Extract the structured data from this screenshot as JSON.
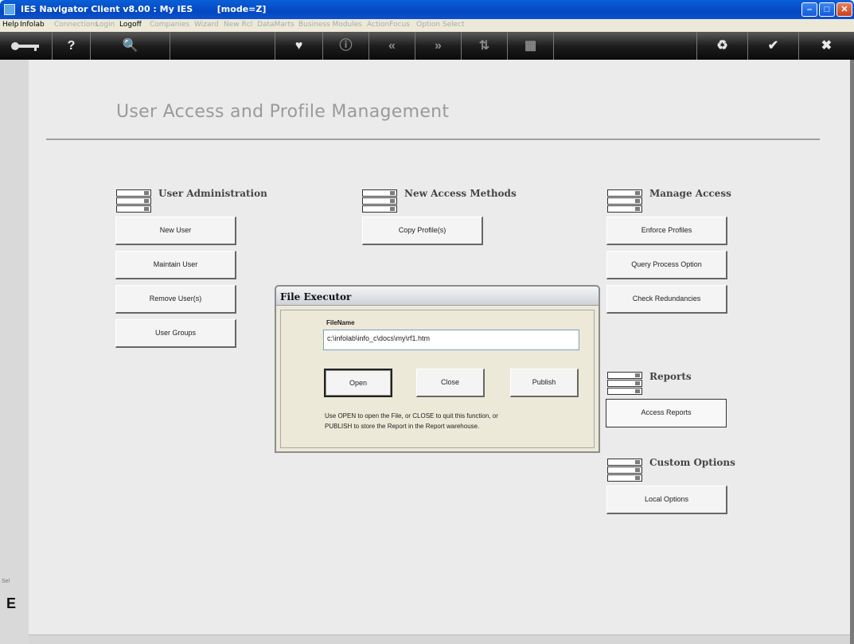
{
  "window": {
    "title": "IES Navigator Client v8.00 : My IES        [mode=Z]",
    "min_label": "–",
    "max_label": "□",
    "close_label": "✕"
  },
  "menu": [
    {
      "label": "Help",
      "dim": false
    },
    {
      "label": "Infolab",
      "dim": false
    },
    {
      "label": "Connections",
      "dim": true
    },
    {
      "label": "Login",
      "dim": true
    },
    {
      "label": "Logoff",
      "dim": false
    },
    {
      "label": "Companies",
      "dim": true
    },
    {
      "label": "Wizard",
      "dim": true
    },
    {
      "label": "New Rcl",
      "dim": true
    },
    {
      "label": "DataMarts",
      "dim": true
    },
    {
      "label": "Business Modules",
      "dim": true
    },
    {
      "label": "ActionFocus",
      "dim": true
    },
    {
      "label": "Option Select",
      "dim": true
    }
  ],
  "toolbar": {
    "key_icon": "key-icon",
    "help_icon": "?",
    "search_icon": "🔍",
    "heart_icon": "♥",
    "info_icon": "ⓘ",
    "back_icon": "«",
    "forward_icon": "»",
    "sort_icon": "⇅",
    "grid_icon": "▦",
    "refresh_icon": "♻",
    "ok_icon": "✔",
    "close_icon": "✖"
  },
  "page": {
    "title": "User Access and Profile Management"
  },
  "sections": {
    "user_admin": {
      "heading": "User Administration",
      "buttons": [
        "New User",
        "Maintain User",
        "Remove User(s)",
        "User Groups"
      ]
    },
    "new_access": {
      "heading": "New Access Methods",
      "buttons": [
        "Copy Profile(s)"
      ]
    },
    "manage_access": {
      "heading": "Manage Access",
      "buttons": [
        "Enforce Profiles",
        "Query Process Option",
        "Check Redundancies"
      ]
    },
    "reports": {
      "heading": "Reports",
      "buttons": [
        "Access Reports"
      ]
    },
    "custom_options": {
      "heading": "Custom Options",
      "buttons": [
        "Local Options"
      ]
    }
  },
  "dialog": {
    "title": "File Executor",
    "filename_label": "FileName",
    "filename_value": "c:\\infolab\\info_c\\docs\\my\\rf1.htm",
    "open_label": "Open",
    "close_label": "Close",
    "publish_label": "Publish",
    "hint_line1": "Use OPEN to open the File, or CLOSE to quit this function, or",
    "hint_line2": "PUBLISH to store the Report in the Report warehouse."
  },
  "side": {
    "small_text": "Sel",
    "big_letter": "E"
  }
}
